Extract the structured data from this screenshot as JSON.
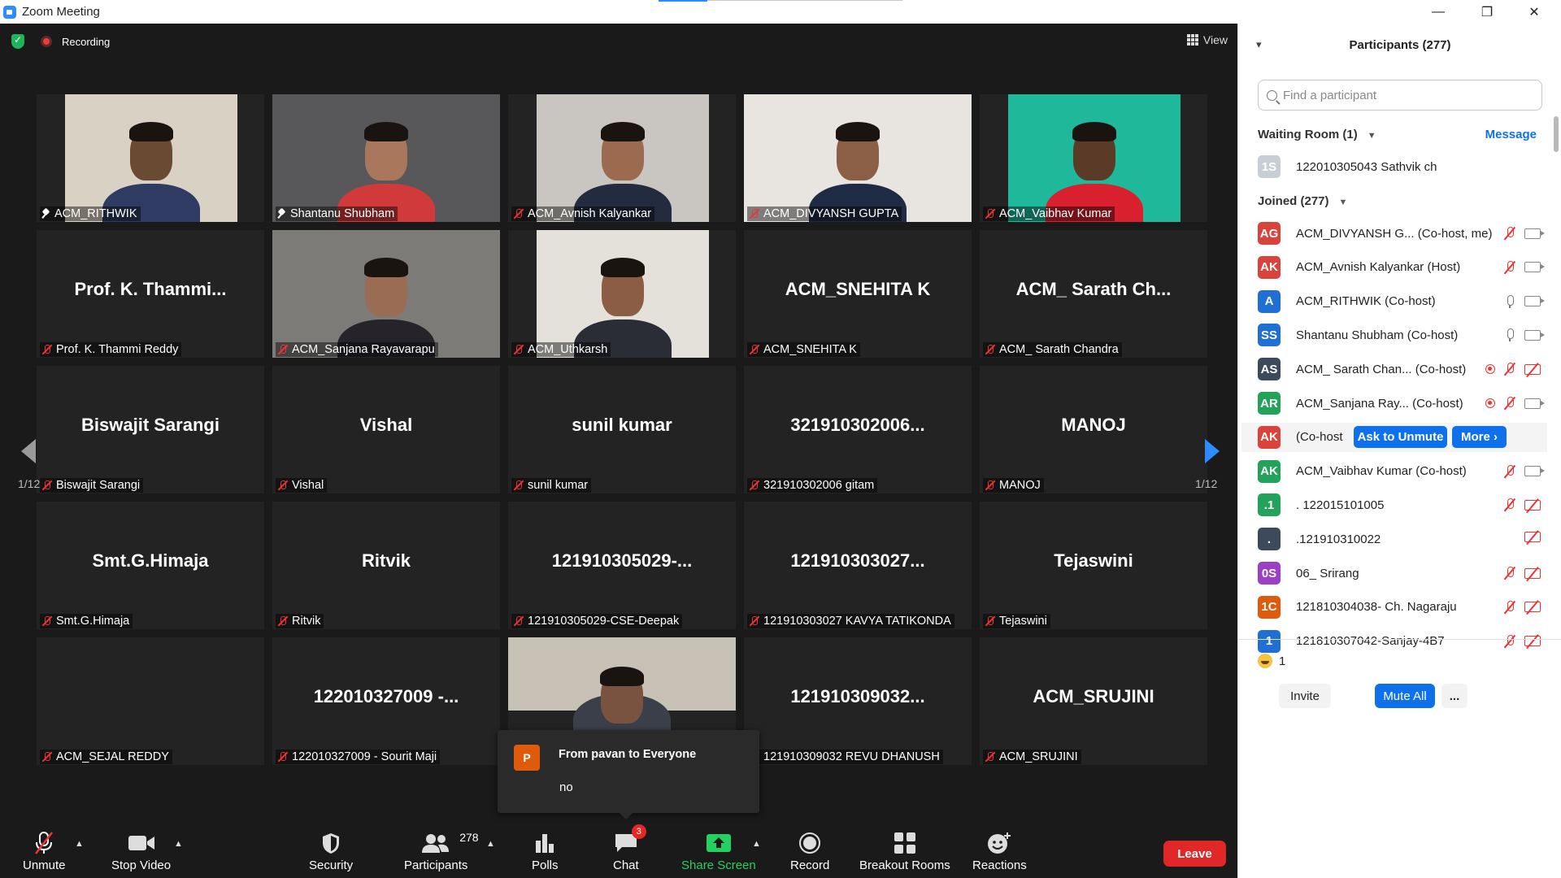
{
  "window": {
    "title": "Zoom Meeting",
    "minimize": "—",
    "restore": "❐",
    "close": "✕"
  },
  "meeting": {
    "recording_label": "Recording",
    "view_label": "View",
    "page_left": "1/12",
    "page_right": "1/12"
  },
  "tiles": [
    {
      "big": "",
      "label": "ACM_RITHWIK",
      "muted": false,
      "pinned": true
    },
    {
      "big": "",
      "label": "Shantanu Shubham",
      "muted": false,
      "pinned": true
    },
    {
      "big": "",
      "label": "ACM_Avnish Kalyankar",
      "muted": true
    },
    {
      "big": "",
      "label": "ACM_DIVYANSH GUPTA",
      "muted": true
    },
    {
      "big": "",
      "label": "ACM_Vaibhav Kumar",
      "muted": true
    },
    {
      "big": "Prof. K. Thammi...",
      "label": "Prof. K. Thammi Reddy",
      "muted": true
    },
    {
      "big": "",
      "label": "ACM_Sanjana Rayavarapu",
      "muted": true
    },
    {
      "big": "",
      "label": "ACM_Uthkarsh",
      "muted": true
    },
    {
      "big": "ACM_SNEHITA K",
      "label": "ACM_SNEHITA K",
      "muted": true
    },
    {
      "big": "ACM_ Sarath Ch...",
      "label": "ACM_ Sarath Chandra",
      "muted": true
    },
    {
      "big": "Biswajit Sarangi",
      "label": "Biswajit Sarangi",
      "muted": true
    },
    {
      "big": "Vishal",
      "label": "Vishal",
      "muted": true
    },
    {
      "big": "sunil kumar",
      "label": "sunil kumar",
      "muted": true
    },
    {
      "big": "321910302006...",
      "label": "321910302006 gitam",
      "muted": true
    },
    {
      "big": "MANOJ",
      "label": "MANOJ",
      "muted": true
    },
    {
      "big": "Smt.G.Himaja",
      "label": "Smt.G.Himaja",
      "muted": true
    },
    {
      "big": "Ritvik",
      "label": "Ritvik",
      "muted": true
    },
    {
      "big": "121910305029-...",
      "label": "121910305029-CSE-Deepak",
      "muted": true
    },
    {
      "big": "121910303027...",
      "label": "121910303027 KAVYA TATIKONDA",
      "muted": true
    },
    {
      "big": "Tejaswini",
      "label": "Tejaswini",
      "muted": true
    },
    {
      "big": "",
      "label": "ACM_SEJAL REDDY",
      "muted": true
    },
    {
      "big": "122010327009 -...",
      "label": "122010327009 - Sourit Maji",
      "muted": true
    },
    {
      "big": "",
      "label": "",
      "muted": false
    },
    {
      "big": "121910309032...",
      "label": "121910309032 REVU DHANUSH",
      "muted": true
    },
    {
      "big": "ACM_SRUJINI",
      "label": "ACM_SRUJINI",
      "muted": true
    }
  ],
  "chat_popup": {
    "avatar": "P",
    "from": "From pavan to Everyone",
    "message": "no"
  },
  "toolbar": {
    "unmute": "Unmute",
    "stop_video": "Stop Video",
    "security": "Security",
    "participants": "Participants",
    "participants_count": "278",
    "polls": "Polls",
    "chat": "Chat",
    "chat_badge": "3",
    "share_screen": "Share Screen",
    "record": "Record",
    "breakout_rooms": "Breakout Rooms",
    "reactions": "Reactions",
    "leave": "Leave"
  },
  "panel": {
    "title": "Participants (277)",
    "search_placeholder": "Find a participant",
    "waiting_room": "Waiting Room (1)",
    "message": "Message",
    "joined": "Joined (277)",
    "waiting": [
      {
        "initials": "1S",
        "name": "122010305043 Sathvik ch",
        "color": "#c9ced6"
      }
    ],
    "participants": [
      {
        "initials": "AG",
        "name": "ACM_DIVYANSH G... (Co-host, me)",
        "color": "#d9433c",
        "mic": "muted",
        "cam": "on",
        "rec": false
      },
      {
        "initials": "AK",
        "name": "ACM_Avnish Kalyankar (Host)",
        "color": "#d9433c",
        "mic": "muted",
        "cam": "on",
        "rec": false
      },
      {
        "initials": "A",
        "name": "ACM_RITHWIK (Co-host)",
        "color": "#1f6fd6",
        "mic": "on",
        "cam": "on",
        "rec": false
      },
      {
        "initials": "SS",
        "name": "Shantanu Shubham (Co-host)",
        "color": "#1f6fd6",
        "mic": "on",
        "cam": "on",
        "rec": false
      },
      {
        "initials": "AS",
        "name": "ACM_ Sarath Chan... (Co-host)",
        "color": "#3d4a5c",
        "mic": "muted",
        "cam": "off",
        "rec": true
      },
      {
        "initials": "AR",
        "name": "ACM_Sanjana Ray... (Co-host)",
        "color": "#23a259",
        "mic": "muted",
        "cam": "on",
        "rec": true
      },
      {
        "initials": "AK",
        "name": "(Co-host",
        "color": "#d9433c",
        "hover": true
      },
      {
        "initials": "AK",
        "name": "ACM_Vaibhav Kumar (Co-host)",
        "color": "#23a259",
        "mic": "muted",
        "cam": "on",
        "rec": false
      },
      {
        "initials": ".1",
        "name": ". 122015101005",
        "color": "#23a259",
        "mic": "muted",
        "cam": "off",
        "rec": false
      },
      {
        "initials": ".",
        "name": ".121910310022",
        "color": "#3d4a5c",
        "mic": "none",
        "cam": "off",
        "rec": false
      },
      {
        "initials": "0S",
        "name": "06_ Srirang",
        "color": "#9b3fc4",
        "mic": "muted",
        "cam": "off",
        "rec": false
      },
      {
        "initials": "1C",
        "name": "121810304038- Ch. Nagaraju",
        "color": "#e05a0c",
        "mic": "muted",
        "cam": "off",
        "rec": false
      },
      {
        "initials": "1",
        "name": "121810307042-Sanjay-4B7",
        "color": "#1f6fd6",
        "mic": "muted",
        "cam": "off",
        "rec": false
      }
    ],
    "ask_to_unmute": "Ask to Unmute",
    "more": "More ›",
    "reaction_count": "1",
    "invite": "Invite",
    "mute_all": "Mute All",
    "ellipsis": "..."
  }
}
